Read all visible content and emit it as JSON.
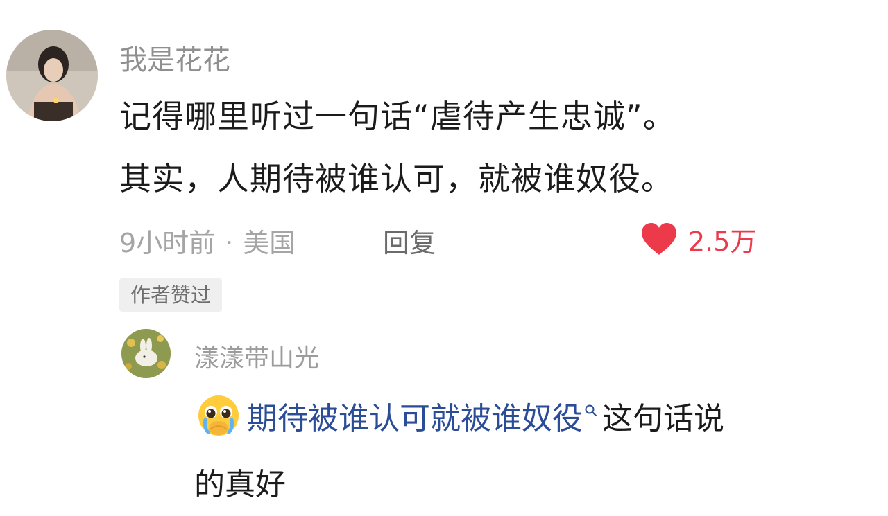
{
  "comment": {
    "username": "我是花花",
    "text_line1": "记得哪里听过一句话“虐待产生忠诚”。",
    "text_line2": "其实，人期待被谁认可，就被谁奴役。",
    "time": "9小时前",
    "separator": "·",
    "location": "美国",
    "reply_label": "回复",
    "like_count": "2.5万",
    "author_badge": "作者赞过",
    "like_color": "#ec3a4b"
  },
  "reply": {
    "username": "漾漾带山光",
    "emoji": "pleading-face-emoji",
    "highlight_text": "期待被谁认可就被谁奴役",
    "text_after": "这句话说",
    "text_line2": "的真好",
    "link_color": "#2b4d98"
  }
}
